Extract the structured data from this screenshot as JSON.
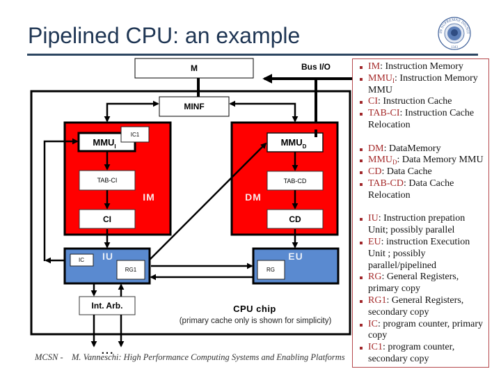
{
  "slide": {
    "title": "Pipelined CPU: an example",
    "logo": {
      "motto": "IN SUPREMAE DIGNITATIS",
      "year": "1343"
    },
    "footer": {
      "left": "MCSN -",
      "right": "M. Vanneschi: High Performance Computing Systems and Enabling Platforms"
    }
  },
  "diagram": {
    "memory": "M",
    "bus_io": "Bus I/O",
    "minf": "MINF",
    "im": {
      "label": "IM",
      "mmu": "MMU",
      "mmu_sub": "I",
      "ic1": "IC1",
      "tab": "TAB-CI",
      "cache": "CI"
    },
    "dm": {
      "label": "DM",
      "mmu": "MMU",
      "mmu_sub": "D",
      "tab": "TAB-CD",
      "cache": "CD"
    },
    "iu": {
      "label": "IU",
      "ic": "IC",
      "rg1": "RG1"
    },
    "eu": {
      "label": "EU",
      "rg": "RG"
    },
    "int_arb": "Int. Arb.",
    "ellipsis": "...",
    "chip": {
      "title": "CPU chip",
      "subtitle": "(primary cache only is shown for simplicity)"
    },
    "colors": {
      "memory_unit": "#ff0000",
      "processing_unit": "#5a8ad0",
      "legend_term": "#a52a2a"
    }
  },
  "legend": {
    "groups": [
      [
        {
          "term": "IM",
          "desc": ": Instruction Memory"
        },
        {
          "term": "MMU",
          "sub": "I",
          "desc": ": Instruction Memory MMU"
        },
        {
          "term": "CI",
          "desc": ": Instruction Cache"
        },
        {
          "term": "TAB-CI",
          "desc": ": Instruction Cache Relocation"
        }
      ],
      [
        {
          "term": "DM",
          "desc": ": DataMemory"
        },
        {
          "term": "MMU",
          "sub": "D",
          "desc": ": Data Memory MMU"
        },
        {
          "term": "CD",
          "desc": ": Data Cache"
        },
        {
          "term": "TAB-CD",
          "desc": ": Data Cache Relocation"
        }
      ],
      [
        {
          "term": "IU",
          "desc": ": Instruction prepation Unit; possibly parallel"
        },
        {
          "term": "EU",
          "desc": ": instruction Execution Unit ; possibly parallel/pipelined"
        },
        {
          "term": "RG",
          "desc": ": General Registers, primary copy"
        },
        {
          "term": "RG1",
          "desc": ": General Registers, secondary copy"
        },
        {
          "term": "IC",
          "desc": ": program counter, primary copy"
        },
        {
          "term": "IC1",
          "desc": ": program counter, secondary copy"
        }
      ]
    ]
  }
}
